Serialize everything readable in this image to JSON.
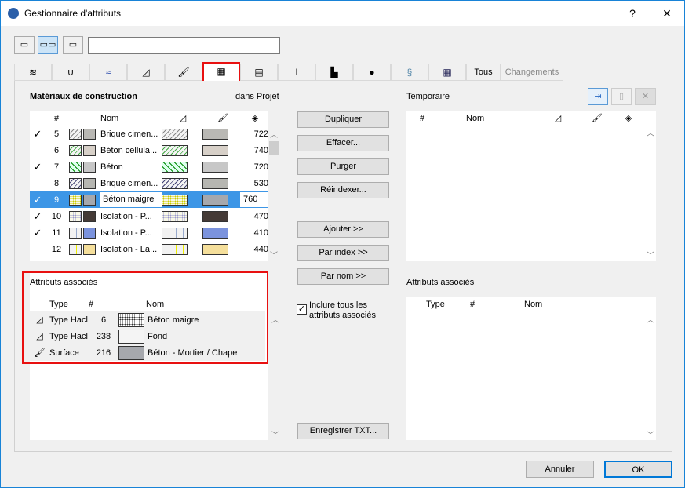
{
  "window": {
    "title": "Gestionnaire d'attributs",
    "help": "?",
    "close": "✕"
  },
  "search": {
    "value": ""
  },
  "tabs": [
    "layers",
    "pen",
    "line",
    "hatch",
    "surface",
    "building-material",
    "composite",
    "profile",
    "zone",
    "environment",
    "mep",
    "grid"
  ],
  "tabs_text": {
    "all": "Tous",
    "changes": "Changements"
  },
  "left": {
    "title": "Matériaux de construction",
    "scope": "dans Projet",
    "columns": {
      "num": "#",
      "name": "Nom"
    },
    "rows": [
      {
        "check": true,
        "num": "5",
        "name": "Brique cimen...",
        "hatch": "diag",
        "fg": "#888",
        "surf": "#b9b8b4",
        "val": "722"
      },
      {
        "check": false,
        "num": "6",
        "name": "Béton cellula...",
        "hatch": "diaggreen",
        "fg": "#4a4",
        "surf": "#d7d0c8",
        "val": "740"
      },
      {
        "check": true,
        "num": "7",
        "name": "Béton",
        "hatch": "cross",
        "fg": "#080",
        "surf": "#c7c7c7",
        "val": "720"
      },
      {
        "check": false,
        "num": "8",
        "name": "Brique cimen...",
        "hatch": "diag",
        "fg": "#447",
        "surf": "#b6b6b1",
        "val": "530"
      },
      {
        "check": true,
        "num": "9",
        "name": "Béton maigre",
        "hatch": "dots",
        "fg": "#cc0",
        "surf": "#a6a8ad",
        "val": "760",
        "selected": true
      },
      {
        "check": true,
        "num": "10",
        "name": "Isolation - P...",
        "hatch": "dots",
        "fg": "#99c",
        "surf": "#443a36",
        "val": "470"
      },
      {
        "check": true,
        "num": "11",
        "name": "Isolation - P...",
        "hatch": "vlines",
        "fg": "#9ac",
        "surf": "#7b93dd",
        "val": "410"
      },
      {
        "check": false,
        "num": "12",
        "name": "Isolation - La...",
        "hatch": "vlines",
        "fg": "#ee0",
        "surf": "#f5df9b",
        "val": "440"
      }
    ]
  },
  "assoc_left": {
    "title": "Attributs associés",
    "columns": {
      "type": "Type",
      "num": "#",
      "name": "Nom"
    },
    "rows": [
      {
        "type": "Type Hacl",
        "num": "6",
        "name": "Béton maigre",
        "sw": "#fff"
      },
      {
        "type": "Type Hacl",
        "num": "238",
        "name": "Fond",
        "sw": "#f4f4f4"
      },
      {
        "type": "Surface",
        "num": "216",
        "name": "Béton - Mortier / Chape",
        "sw": "#a6a8ad"
      }
    ]
  },
  "buttons": {
    "duplicate": "Dupliquer",
    "delete": "Effacer...",
    "purge": "Purger",
    "reindex": "Réindexer...",
    "add": "Ajouter >>",
    "by_index": "Par index >>",
    "by_name": "Par nom >>",
    "include": "Inclure tous les attributs associés",
    "save_txt": "Enregistrer TXT..."
  },
  "include_checked": true,
  "right": {
    "title": "Temporaire",
    "columns": {
      "num": "#",
      "name": "Nom"
    },
    "assoc_title": "Attributs associés",
    "assoc_columns": {
      "type": "Type",
      "num": "#",
      "name": "Nom"
    }
  },
  "footer": {
    "cancel": "Annuler",
    "ok": "OK"
  }
}
